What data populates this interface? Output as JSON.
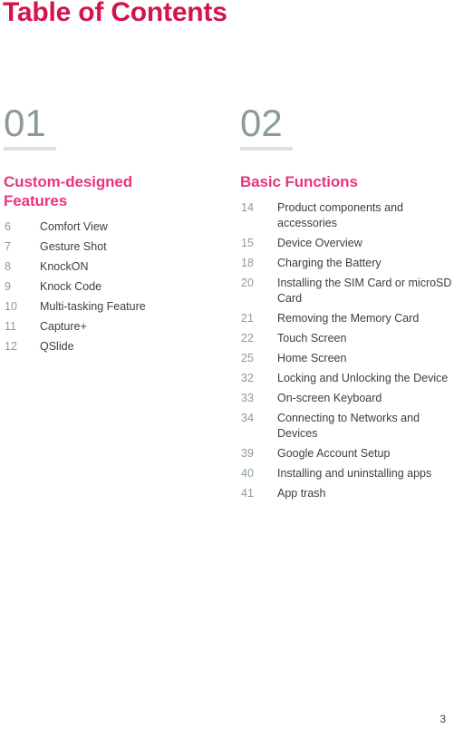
{
  "document": {
    "title": "Table of Contents",
    "footer_page_number": "3"
  },
  "colors": {
    "title_red": "#D4144A",
    "heading_pink": "#E8357F",
    "number_slate": "#8C9A9A",
    "rule_gray": "#DDE1E2",
    "entry_title_gray": "#3A3F42",
    "footer_gray": "#3A4A4E",
    "background": "#FFFFFF"
  },
  "sections": [
    {
      "number": "01",
      "heading": "Custom-designed Features",
      "entries": [
        {
          "page": "6",
          "title": "Comfort View"
        },
        {
          "page": "7",
          "title": "Gesture Shot"
        },
        {
          "page": "8",
          "title": "KnockON"
        },
        {
          "page": "9",
          "title": "Knock Code"
        },
        {
          "page": "10",
          "title": "Multi-tasking Feature"
        },
        {
          "page": "11",
          "title": "Capture+"
        },
        {
          "page": "12",
          "title": "QSlide"
        }
      ]
    },
    {
      "number": "02",
      "heading": "Basic Functions",
      "entries": [
        {
          "page": "14",
          "title": "Product components and accessories"
        },
        {
          "page": "15",
          "title": "Device Overview"
        },
        {
          "page": "18",
          "title": "Charging the Battery"
        },
        {
          "page": "20",
          "title": "Installing the SIM Card or microSD Card"
        },
        {
          "page": "21",
          "title": "Removing the Memory Card"
        },
        {
          "page": "22",
          "title": "Touch Screen"
        },
        {
          "page": "25",
          "title": "Home Screen"
        },
        {
          "page": "32",
          "title": "Locking and Unlocking the Device"
        },
        {
          "page": "33",
          "title": "On-screen Keyboard"
        },
        {
          "page": "34",
          "title": "Connecting to Networks and Devices"
        },
        {
          "page": "39",
          "title": "Google Account Setup"
        },
        {
          "page": "40",
          "title": "Installing and uninstalling apps"
        },
        {
          "page": "41",
          "title": "App trash"
        }
      ]
    }
  ]
}
